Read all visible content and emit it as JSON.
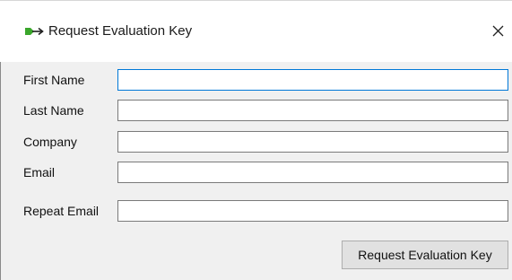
{
  "window": {
    "title": "Request Evaluation Key",
    "icon": "green-arrow-icon",
    "close_glyph": "✕"
  },
  "form": {
    "fields": [
      {
        "label": "First Name",
        "value": "",
        "focused": true
      },
      {
        "label": "Last Name",
        "value": "",
        "focused": false
      },
      {
        "label": "Company",
        "value": "",
        "focused": false
      },
      {
        "label": "Email",
        "value": "",
        "focused": false
      },
      {
        "label": "Repeat Email",
        "value": "",
        "focused": false
      }
    ],
    "submit_label": "Request Evaluation Key"
  },
  "colors": {
    "focus_border": "#0078d7",
    "client_background": "#f0f0f0",
    "icon_green": "#3aa62b"
  }
}
